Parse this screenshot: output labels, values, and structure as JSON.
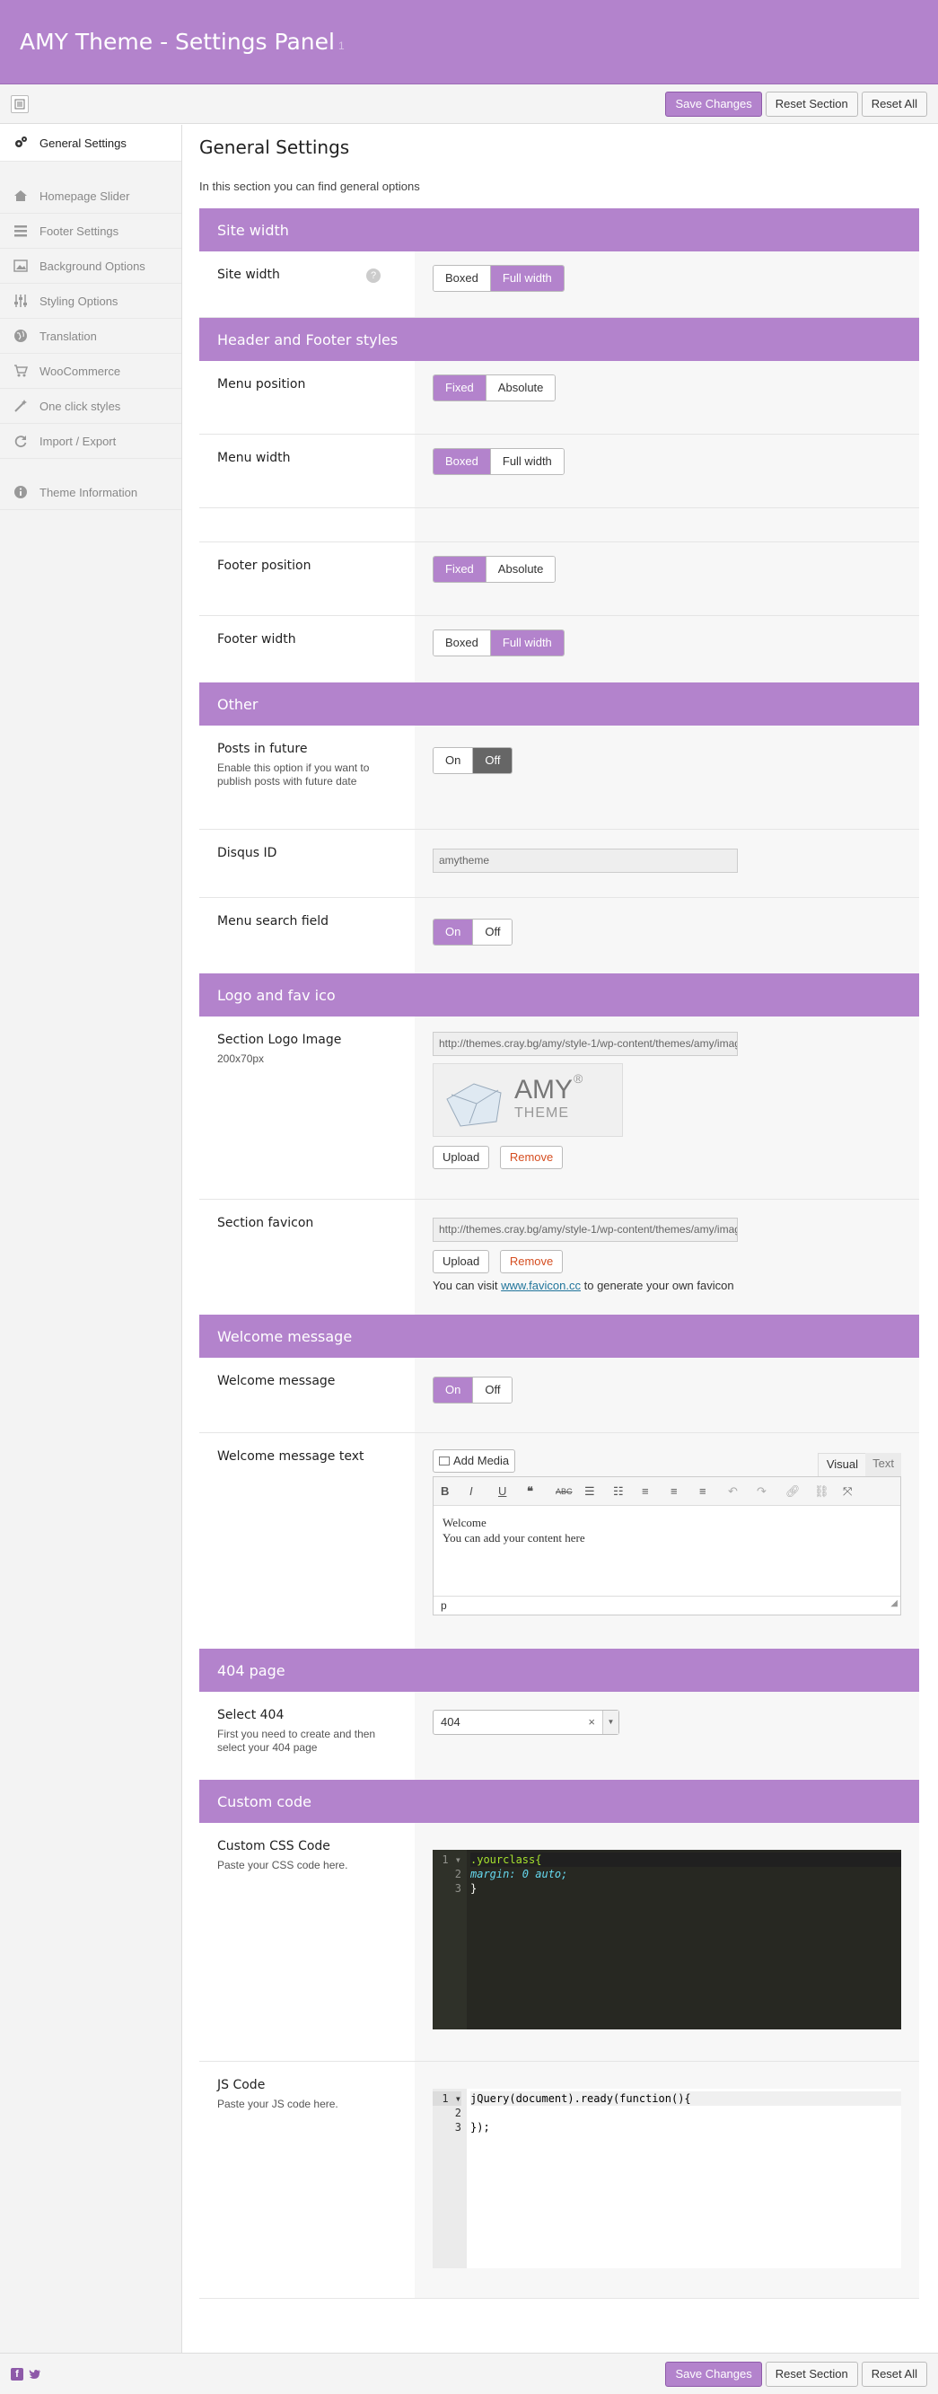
{
  "header": {
    "title": "AMY Theme - Settings Panel",
    "version": "1"
  },
  "toolbar": {
    "save": "Save Changes",
    "reset_section": "Reset Section",
    "reset_all": "Reset All"
  },
  "sidebar": {
    "items": [
      {
        "label": "General Settings",
        "icon": "gears-icon"
      },
      {
        "label": "Homepage Slider",
        "icon": "home-icon"
      },
      {
        "label": "Footer Settings",
        "icon": "list-icon"
      },
      {
        "label": "Background Options",
        "icon": "image-icon"
      },
      {
        "label": "Styling Options",
        "icon": "sliders-icon"
      },
      {
        "label": "Translation",
        "icon": "globe-icon"
      },
      {
        "label": "WooCommerce",
        "icon": "cart-icon"
      },
      {
        "label": "One click styles",
        "icon": "wand-icon"
      },
      {
        "label": "Import / Export",
        "icon": "refresh-icon"
      },
      {
        "label": "Theme Information",
        "icon": "info-icon"
      }
    ]
  },
  "page": {
    "title": "General Settings",
    "description": "In this section you can find general options"
  },
  "sections": {
    "site_width": {
      "title": "Site width",
      "label": "Site width",
      "opts": [
        "Boxed",
        "Full width"
      ],
      "selected": "Full width"
    },
    "header_footer": {
      "title": "Header and Footer styles",
      "menu_position": {
        "label": "Menu position",
        "opts": [
          "Fixed",
          "Absolute"
        ],
        "selected": "Fixed"
      },
      "menu_width": {
        "label": "Menu width",
        "opts": [
          "Boxed",
          "Full width"
        ],
        "selected": "Boxed"
      },
      "footer_position": {
        "label": "Footer position",
        "opts": [
          "Fixed",
          "Absolute"
        ],
        "selected": "Fixed"
      },
      "footer_width": {
        "label": "Footer width",
        "opts": [
          "Boxed",
          "Full width"
        ],
        "selected": "Full width"
      }
    },
    "other": {
      "title": "Other",
      "posts_future": {
        "label": "Posts in future",
        "desc": "Enable this option if you want to publish posts with future date",
        "opts": [
          "On",
          "Off"
        ],
        "selected": "Off"
      },
      "disqus": {
        "label": "Disqus ID",
        "value": "amytheme"
      },
      "menu_search": {
        "label": "Menu search field",
        "opts": [
          "On",
          "Off"
        ],
        "selected": "On"
      }
    },
    "logo": {
      "title": "Logo and fav ico",
      "logo_label": "Section Logo Image",
      "logo_desc": "200x70px",
      "logo_url": "http://themes.cray.bg/amy/style-1/wp-content/themes/amy/images/logo.png",
      "logo_text": "AMY",
      "logo_sub": "THEME",
      "logo_reg": "®",
      "upload": "Upload",
      "remove": "Remove",
      "fav_label": "Section favicon",
      "fav_url": "http://themes.cray.bg/amy/style-1/wp-content/themes/amy/images/favicon.ico",
      "fav_note_pre": "You can visit ",
      "fav_note_link": "www.favicon.cc",
      "fav_note_post": " to generate your own favicon"
    },
    "welcome": {
      "title": "Welcome message",
      "toggle_label": "Welcome message",
      "opts": [
        "On",
        "Off"
      ],
      "selected": "On",
      "text_label": "Welcome message text",
      "add_media": "Add Media",
      "tab_visual": "Visual",
      "tab_text": "Text",
      "content_line1": "Welcome",
      "content_line2": "You can add your content here",
      "path": "p"
    },
    "page404": {
      "title": "404 page",
      "label": "Select 404",
      "desc": "First you need to create and then select your 404 page",
      "value": "404"
    },
    "custom_code": {
      "title": "Custom code",
      "css_label": "Custom CSS Code",
      "css_desc": "Paste your CSS code here.",
      "css_lines": [
        ".yourclass{",
        "margin: 0 auto;",
        "}"
      ],
      "js_label": "JS Code",
      "js_desc": "Paste your JS code here.",
      "js_lines": [
        "jQuery(document).ready(function(){",
        "",
        "});"
      ]
    }
  },
  "colors": {
    "accent": "#b383cc",
    "code_bg": "#272822"
  }
}
